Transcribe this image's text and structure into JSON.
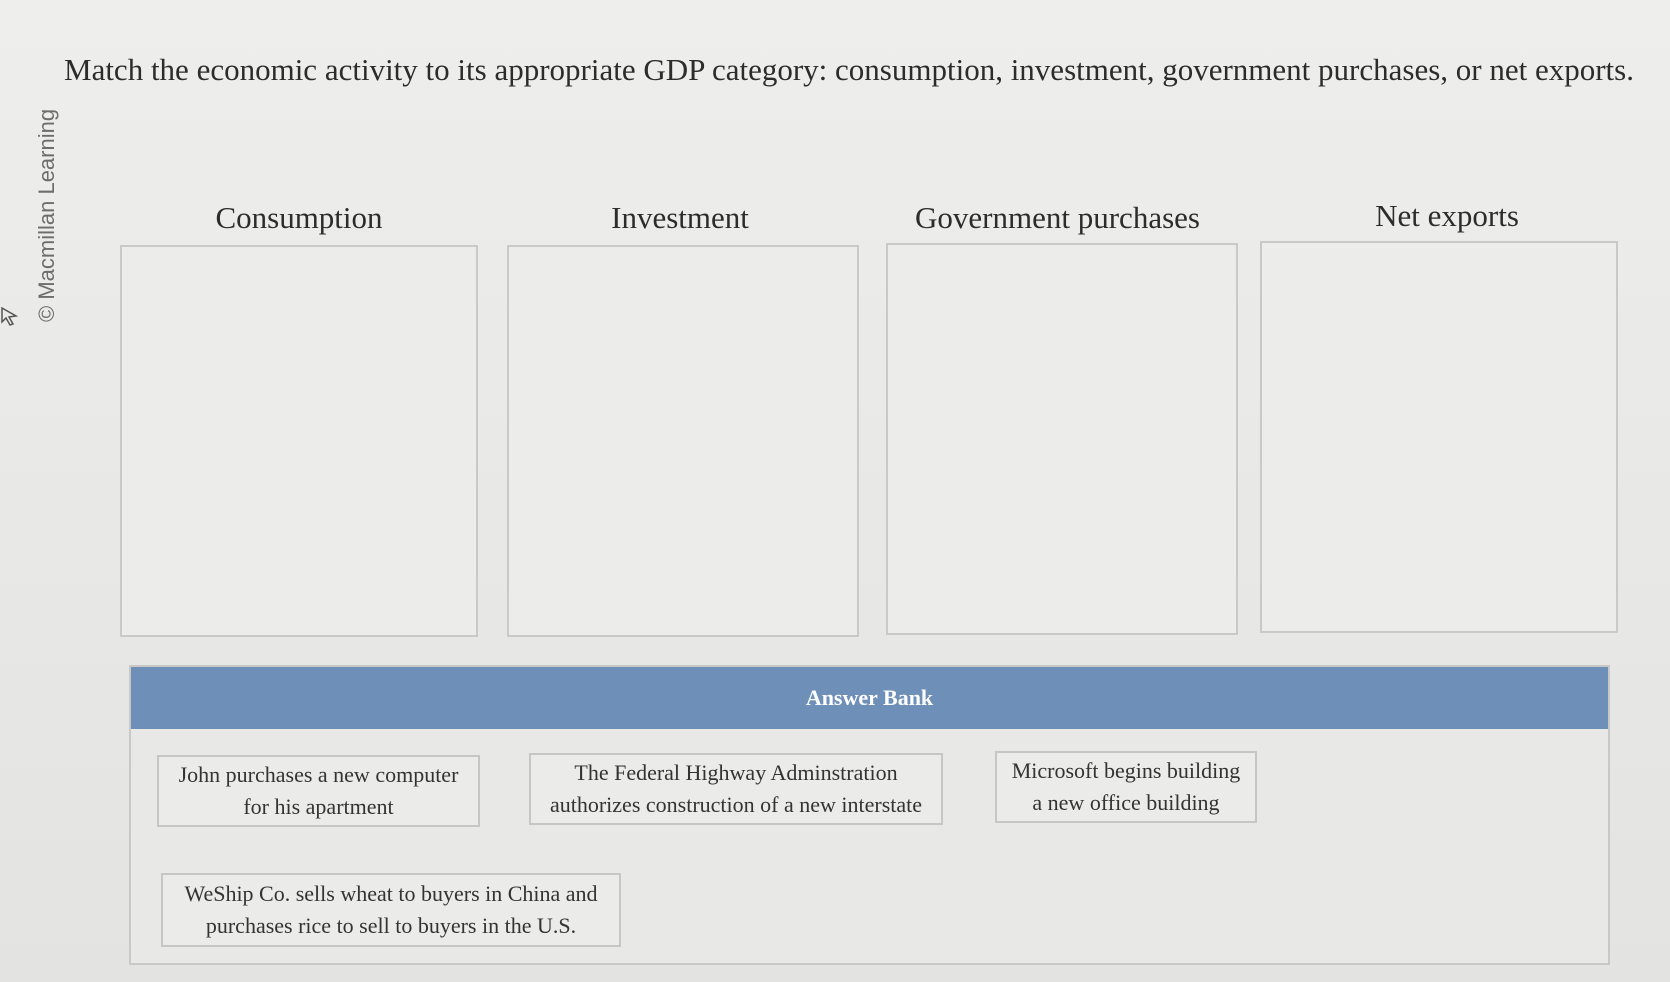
{
  "watermark": "© Macmillan Learning",
  "question": "Match the economic activity to its appropriate GDP category: consumption, investment, government purchases, or net exports.",
  "categories": [
    {
      "label": "Consumption"
    },
    {
      "label": "Investment"
    },
    {
      "label": "Government purchases"
    },
    {
      "label": "Net exports"
    }
  ],
  "answer_bank": {
    "title": "Answer Bank",
    "items": [
      {
        "line1": "John purchases a new computer",
        "line2": "for his apartment"
      },
      {
        "line1": "The Federal Highway Adminstration",
        "line2": "authorizes construction of a new interstate"
      },
      {
        "line1": "Microsoft begins building",
        "line2": "a new office building"
      },
      {
        "line1": "WeShip Co. sells wheat to buyers in China and",
        "line2": "purchases rice to sell to buyers in the U.S."
      }
    ]
  },
  "icons": {
    "cursor": "cursor-arrow-icon"
  }
}
